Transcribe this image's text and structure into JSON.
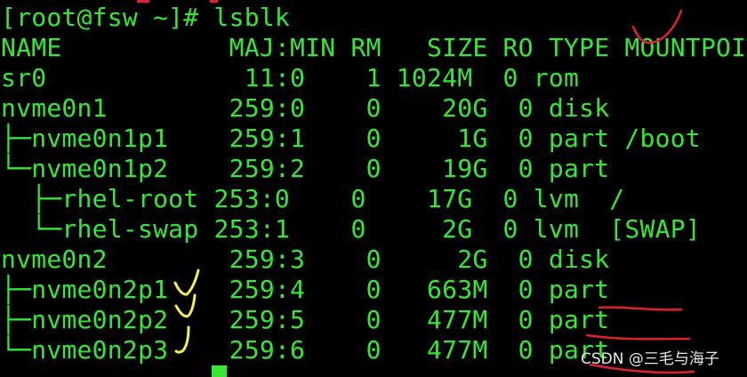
{
  "terminal": {
    "colors": {
      "background": "#000000",
      "text": "#34e834",
      "red_annotation": "#e2202c",
      "yellow_annotation": "#f2ee55"
    },
    "lines": [
      "[root@fsw ~]# lsblk",
      "NAME           MAJ:MIN RM   SIZE RO TYPE MOUNTPOINT",
      "sr0             11:0    1 1024M  0 rom",
      "nvme0n1        259:0    0    20G  0 disk",
      "├─nvme0n1p1    259:1    0     1G  0 part /boot",
      "└─nvme0n1p2    259:2    0    19G  0 part",
      "  ├─rhel-root 253:0    0    17G  0 lvm  /",
      "  └─rhel-swap 253:1    0     2G  0 lvm  [SWAP]",
      "nvme0n2        259:3    0     2G  0 disk",
      "├─nvme0n2p1    259:4    0   663M  0 part",
      "├─nvme0n2p2    259:5    0   477M  0 part",
      "└─nvme0n2p3    259:6    0   477M  0 part"
    ]
  },
  "watermark": "CSDN @三毛与海子"
}
